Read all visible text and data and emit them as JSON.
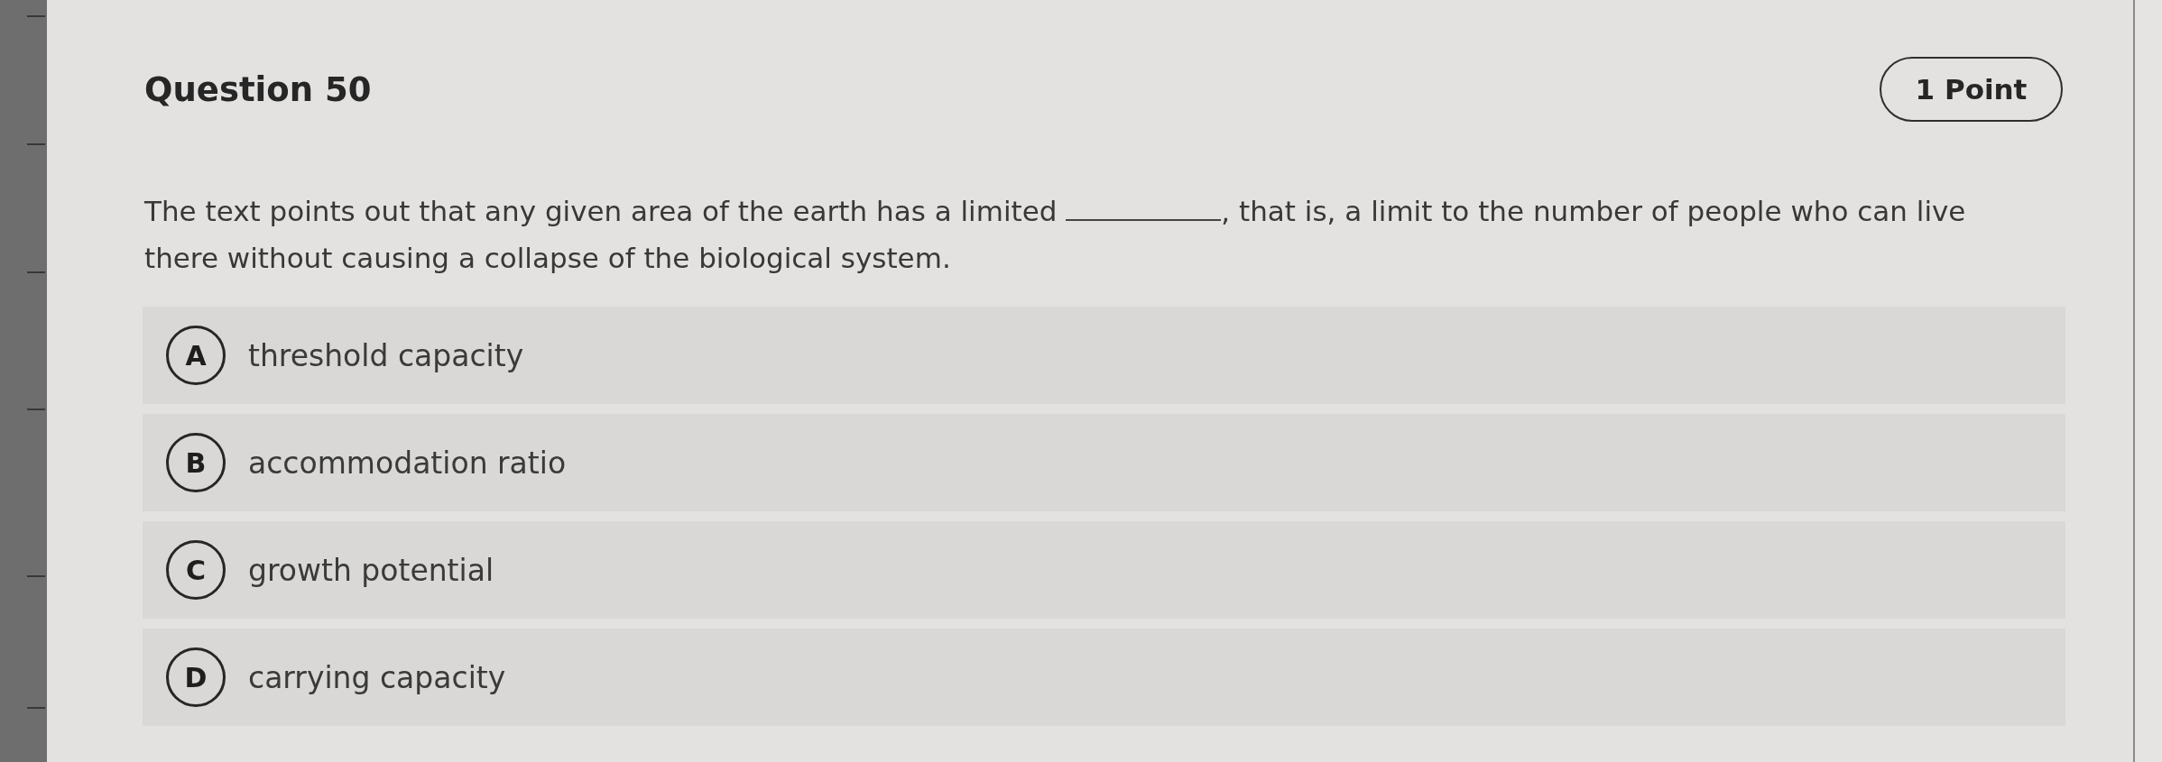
{
  "question": {
    "title": "Question 50",
    "points": "1 Point",
    "text_before": "The text points out that any given area of the earth has a limited ",
    "text_after": ", that is, a limit to the number of people who can live there without causing a collapse of the biological system."
  },
  "options": [
    {
      "letter": "A",
      "text": "threshold capacity",
      "selected": false
    },
    {
      "letter": "B",
      "text": "accommodation ratio",
      "selected": false
    },
    {
      "letter": "C",
      "text": "growth potential",
      "selected": false
    },
    {
      "letter": "D",
      "text": "carrying capacity",
      "selected": false
    }
  ]
}
